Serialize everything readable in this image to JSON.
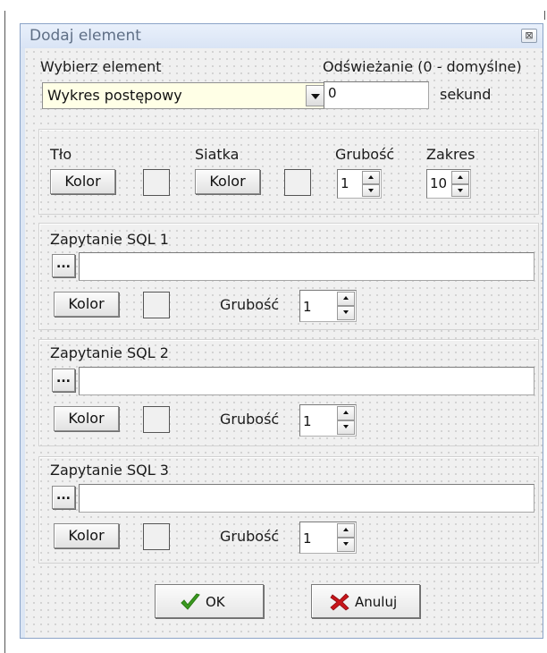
{
  "dialog": {
    "title": "Dodaj element",
    "close_glyph": "⊠",
    "element_label": "Wybierz element",
    "element_value": "Wykres postępowy",
    "refresh_label": "Odświeżanie (0 - domyślne)",
    "refresh_value": "0",
    "seconds_label": "sekund"
  },
  "background_group": {
    "bg_label": "Tło",
    "bg_color_button": "Kolor",
    "grid_label": "Siatka",
    "grid_color_button": "Kolor",
    "thickness_label": "Grubość",
    "thickness_value": "1",
    "range_label": "Zakres",
    "range_value": "10"
  },
  "sql_groups": [
    {
      "title": "Zapytanie SQL 1",
      "browse_label": "...",
      "query": "",
      "color_button": "Kolor",
      "thickness_label": "Grubość",
      "thickness_value": "1"
    },
    {
      "title": "Zapytanie SQL 2",
      "browse_label": "...",
      "query": "",
      "color_button": "Kolor",
      "thickness_label": "Grubość",
      "thickness_value": "1"
    },
    {
      "title": "Zapytanie SQL 3",
      "browse_label": "...",
      "query": "",
      "color_button": "Kolor",
      "thickness_label": "Grubość",
      "thickness_value": "1"
    }
  ],
  "buttons": {
    "ok": "OK",
    "cancel": "Anuluj"
  },
  "icons": {
    "ok": "check-icon",
    "cancel": "x-icon"
  },
  "colors": {
    "ok_icon": "#3a9a1f",
    "cancel_icon": "#c8141a",
    "combo_bg": "#ffffe6",
    "title_text": "#5f6f86"
  }
}
